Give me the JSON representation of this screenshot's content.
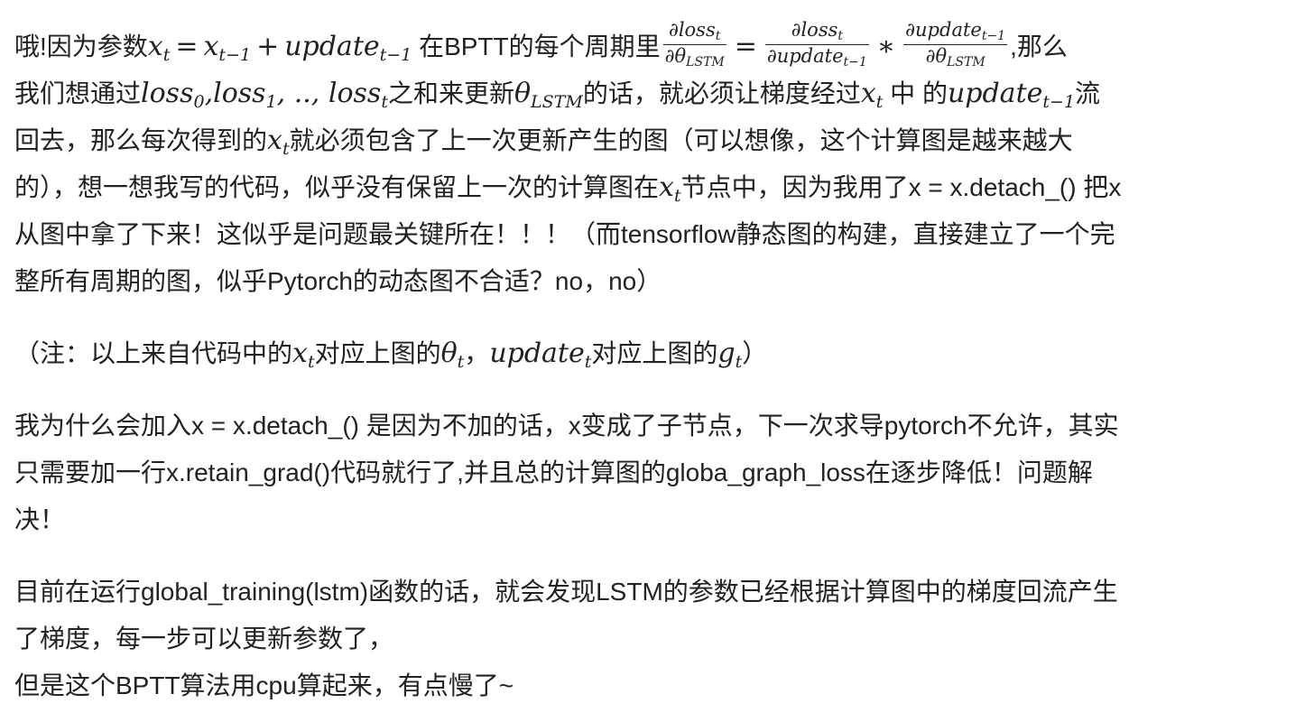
{
  "paragraphs": {
    "p1": {
      "l1_a": "哦!因为参数",
      "l1_xt": "x",
      "l1_t": "t",
      "l1_eq": "=",
      "l1_x": "x",
      "l1_tm1": "t−1",
      "l1_plus": "+",
      "l1_update": "update",
      "l1_tm1b": "t−1",
      "l1_b": "在BPTT的每个周期里",
      "frac1_num": "∂loss",
      "frac1_num_sub": "t",
      "frac1_den": "∂θ",
      "frac1_den_sub": "LSTM",
      "l1_eq2": "=",
      "frac2_num": "∂loss",
      "frac2_num_sub": "t",
      "frac2_den": "∂update",
      "frac2_den_sub": "t−1",
      "l1_times": "∗",
      "frac3_num": "∂update",
      "frac3_num_sub": "t−1",
      "frac3_den": "∂θ",
      "frac3_den_sub": "LSTM",
      "l1_c": ",那么",
      "l2_a": "我们想通过",
      "l2_loss0": "loss",
      "l2_s0": "0",
      "l2_comma1": ",",
      "l2_loss1": "loss",
      "l2_s1": "1",
      "l2_dots": ", .., ",
      "l2_losst": "loss",
      "l2_st": "t",
      "l2_b": "之和来更新",
      "l2_theta": "θ",
      "l2_lstm": "LSTM",
      "l2_c": "的话，就必须让梯度经过",
      "l2_x": "x",
      "l2_xt": "t",
      "l2_d": " 中 的",
      "l2_update": "update",
      "l2_utm1": "t−1",
      "l2_e": "流",
      "l3_a": "回去，那么每次得到的",
      "l3_x": "x",
      "l3_t": "t",
      "l3_b": "就必须包含了上一次更新产生的图（可以想像，这个计算图是越来越大",
      "l4_a": "的），想一想我写的代码，似乎没有保留上一次的计算图在",
      "l4_x": "x",
      "l4_t": "t",
      "l4_b": "节点中，因为我用了x = x.detach_() 把x",
      "l5": "从图中拿了下来！这似乎是问题最关键所在！！！（而tensorflow静态图的构建，直接建立了一个完",
      "l6": "整所有周期的图，似乎Pytorch的动态图不合适？no，no）"
    },
    "p2": {
      "a": "（注：以上来自代码中的",
      "x": "x",
      "xt": "t",
      "b": "对应上图的",
      "theta": "θ",
      "tt": "t",
      "c": "，",
      "update": "update",
      "ut": "t",
      "d": "对应上图的",
      "g": "g",
      "gt": "t",
      "e": "）"
    },
    "p3": {
      "l1": "我为什么会加入x = x.detach_() 是因为不加的话，x变成了子节点，下一次求导pytorch不允许，其实",
      "l2": "只需要加一行x.retain_grad()代码就行了,并且总的计算图的globa_graph_loss在逐步降低！问题解",
      "l3": "决！"
    },
    "p4": {
      "l1": "目前在运行global_training(lstm)函数的话，就会发现LSTM的参数已经根据计算图中的梯度回流产生",
      "l2": "了梯度，每一步可以更新参数了，",
      "l3": "但是这个BPTT算法用cpu算起来，有点慢了~"
    }
  }
}
